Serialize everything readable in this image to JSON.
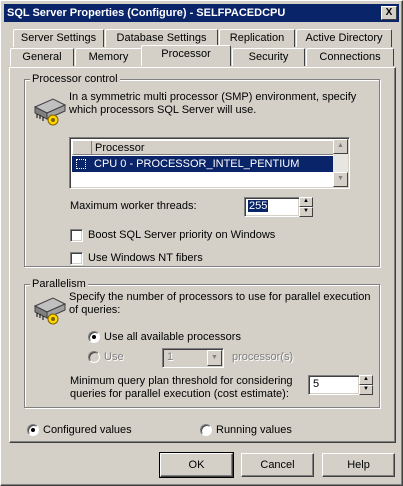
{
  "window": {
    "title": "SQL Server Properties (Configure) - SELFPACEDCPU",
    "close_label": "X"
  },
  "tabs_row1": [
    "Server Settings",
    "Database Settings",
    "Replication",
    "Active Directory"
  ],
  "tabs_row2": [
    "General",
    "Memory",
    "Processor",
    "Security",
    "Connections"
  ],
  "active_tab": "Processor",
  "processor_control": {
    "title": "Processor control",
    "description": "In a symmetric multi processor (SMP) environment, specify which processors SQL Server will use.",
    "list_header": "Processor",
    "processors": [
      "CPU 0 - PROCESSOR_INTEL_PENTIUM"
    ],
    "max_threads_label": "Maximum worker threads:",
    "max_threads_value": "255",
    "boost_label": "Boost SQL Server priority on Windows",
    "fibers_label": "Use Windows NT fibers"
  },
  "parallelism": {
    "title": "Parallelism",
    "description": "Specify the number of processors to use for parallel execution of queries:",
    "use_all_label": "Use all available processors",
    "use_label": "Use",
    "use_count_value": "1",
    "processors_suffix": "processor(s)",
    "threshold_label": "Minimum query plan threshold for considering queries for parallel execution (cost estimate):",
    "threshold_value": "5"
  },
  "values_mode": {
    "configured_label": "Configured values",
    "running_label": "Running values"
  },
  "buttons": {
    "ok": "OK",
    "cancel": "Cancel",
    "help": "Help"
  },
  "colors": {
    "titlebar": "#0a246a",
    "face": "#d4d0c8",
    "selection": "#0a246a"
  }
}
